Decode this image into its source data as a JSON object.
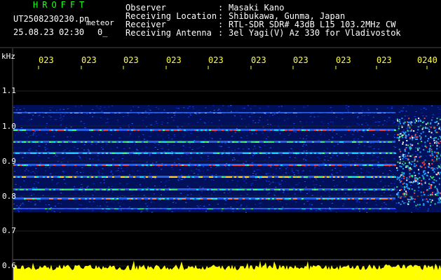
{
  "header": {
    "app_title": "HROFFT",
    "file_name": "UT2508230230.pn",
    "file_type": "meteor",
    "date_time": "25.08.23 02:30",
    "counter": "0_",
    "fields": [
      {
        "label": "Observer",
        "value": "Masaki Kano"
      },
      {
        "label": "Receiving Location",
        "value": "Shibukawa, Gunma, Japan"
      },
      {
        "label": "Receiver",
        "value": "RTL-SDR SDR# 43dB L15 103.2MHz CW"
      },
      {
        "label": "Receiving Antenna",
        "value": "3el Yagi(V) Az 330 for Vladivostok"
      }
    ],
    "separator": ":"
  },
  "axes": {
    "y_unit": "kHz",
    "y_ticks": [
      "1.1",
      "1.0",
      "0.9",
      "0.8",
      "0.7",
      "0.6"
    ],
    "x_ticks": [
      "023",
      "023",
      "023",
      "023",
      "023",
      "023",
      "023",
      "023",
      "023",
      "0240"
    ]
  },
  "colors": {
    "background": "#000000",
    "title": "#22ff22",
    "tick_labels": "#ffff40",
    "signal_strip": "#ffff00"
  }
}
